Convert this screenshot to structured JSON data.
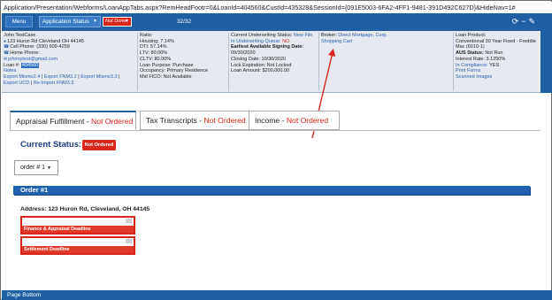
{
  "url": "Application/Presentation/Webforms/LoanAppTabs.aspx?RemHeadFootr=0&LoanId=404560&CustId=435328&SessionId={091E5003-6FA2-4FF1-9481-391D492C627D}&HideNav=1#",
  "toolbar": {
    "menu_label": "Menu",
    "app_status_label": "Application Status",
    "status_value": "Not Done",
    "pager": "32/32",
    "icons": [
      "refresh-icon",
      "minimize-icon",
      "pin-icon"
    ],
    "icon_glyphs": {
      "refresh": "⟳",
      "minimize": "−",
      "pin": "✎"
    }
  },
  "borrower": {
    "name": "John TestCase",
    "address": "123 Huron Rd Cleveland OH 44145",
    "cell": "Cell Phone: (330) 609-4259",
    "home": "Home Phone:",
    "email": "johnnytest@gmail.com",
    "loan_label": "Loan #:",
    "loan_number": "404560",
    "notes": "Notes",
    "links_row1": [
      "Export Mismo2.4",
      "Export FNM3.2",
      "Export Mismo3.3"
    ],
    "links_row2": [
      "Export UCD",
      "Re-Import FNM3.2"
    ]
  },
  "ratios": {
    "title": "Ratio:",
    "housing": "Housing: 7.14%",
    "dti": "DTI: 57.14%",
    "ltv": "LTV: 80.00%",
    "cltv": "CLTV: 80.00%",
    "purpose": "Loan Purpose: Purchase",
    "occupancy": "Occupancy: Primary Residence",
    "fico": "Mid FICO: Not Available"
  },
  "underwriting": {
    "status_label": "Current Underwriting Status:",
    "status_value": "New File",
    "queue_label": "In Underwriting Queue:",
    "queue_value": "NO",
    "signing_label": "Earliest Available Signing Date:",
    "signing_value": "09/30/2020",
    "closing": "Closing Date: 10/30/2020",
    "lock": "Lock Expiration: Not Locked",
    "amount": "Loan Amount: $200,000.00"
  },
  "broker": {
    "label": "Broker:",
    "value": "Direct Mortgage, Corp.",
    "cart": "Shopping Cart"
  },
  "product": {
    "label": "Loan Product:",
    "value": "Conventional 30 Year Fixed - Freddie Mac (6010-1)",
    "aus": "AUS Status:",
    "aus_value": "Not Run",
    "rate": "Interest Rate: 3.1250%",
    "compliance_label": "In Compliance:",
    "compliance_value": "YES",
    "print": "Print Forms",
    "scanned": "Scanned Images"
  },
  "tabs": [
    {
      "label": "Appraisal Fulfillment - ",
      "status": "Not Ordered"
    },
    {
      "label": "Tax Transcripts - ",
      "status": "Not Ordered"
    },
    {
      "label": "Income - ",
      "status": "Not Ordered"
    }
  ],
  "main": {
    "current_status_label": "Current Status:",
    "current_status_value": "Not Ordered",
    "order_select": "order # 1",
    "order_header": "Order #1",
    "address": "Address: 123 Huron Rd, Cleveland, OH 44145",
    "deadline1": "Finance & Appraisal Deadline",
    "deadline2": "Settlement Deadline"
  },
  "footer": {
    "label": "Page Bottom"
  },
  "colors": {
    "primary": "#1f5fa4",
    "alert": "#d9261c",
    "panel": "#e6eaf0"
  }
}
